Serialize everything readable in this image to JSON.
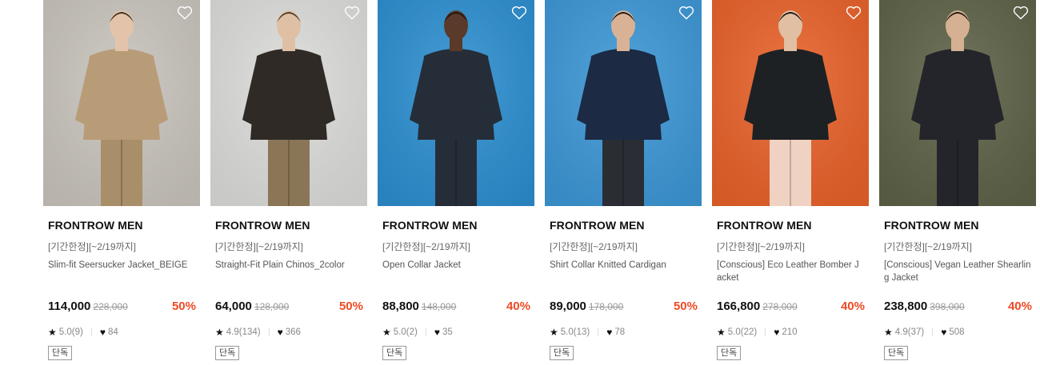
{
  "products": [
    {
      "brand": "FRONTROW MEN",
      "promo": "[기간한정][~2/19까지]",
      "name": "Slim-fit Seersucker Jacket_BEIGE",
      "price": "114,000",
      "original_price": "228,000",
      "discount": "50%",
      "rating": "5.0(9)",
      "likes": "84",
      "badge": "단독",
      "photo_colors": {
        "bg": "#c9c4bd",
        "garment": "#b89c78",
        "pants": "#a98e6a",
        "skin": "#e3c4aa",
        "hair": "#3a2a20"
      }
    },
    {
      "brand": "FRONTROW MEN",
      "promo": "[기간한정][~2/19까지]",
      "name": "Straight-Fit Plain Chinos_2color",
      "price": "64,000",
      "original_price": "128,000",
      "discount": "50%",
      "rating": "4.9(134)",
      "likes": "366",
      "badge": "단독",
      "photo_colors": {
        "bg": "#dcdcda",
        "garment": "#2f2a25",
        "pants": "#8a7657",
        "skin": "#e0c0a4",
        "hair": "#4a3a2a"
      }
    },
    {
      "brand": "FRONTROW MEN",
      "promo": "[기간한정][~2/19까지]",
      "name": "Open Collar Jacket",
      "price": "88,800",
      "original_price": "148,000",
      "discount": "40%",
      "rating": "5.0(2)",
      "likes": "35",
      "badge": "단독",
      "photo_colors": {
        "bg": "#2d8fd0",
        "garment": "#252e38",
        "pants": "#252e38",
        "skin": "#5a3a2a",
        "hair": "#1a1410"
      }
    },
    {
      "brand": "FRONTROW MEN",
      "promo": "[기간한정][~2/19까지]",
      "name": "Shirt Collar Knitted Cardigan",
      "price": "89,000",
      "original_price": "178,000",
      "discount": "50%",
      "rating": "5.0(13)",
      "likes": "78",
      "badge": "단독",
      "photo_colors": {
        "bg": "#3d97d6",
        "garment": "#1c2a44",
        "pants": "#2a2e34",
        "skin": "#d9b296",
        "hair": "#1a1410"
      }
    },
    {
      "brand": "FRONTROW MEN",
      "promo": "[기간한정][~2/19까지]",
      "name": "[Conscious] Eco Leather Bomber Jacket",
      "price": "166,800",
      "original_price": "278,000",
      "discount": "40%",
      "rating": "5.0(22)",
      "likes": "210",
      "badge": "단독",
      "photo_colors": {
        "bg": "#e8622a",
        "garment": "#1d2124",
        "pants": "#f0d2c2",
        "skin": "#e0bfa2",
        "hair": "#1a1410"
      }
    },
    {
      "brand": "FRONTROW MEN",
      "promo": "[기간한정][~2/19까지]",
      "name": "[Conscious] Vegan Leather Shearling Jacket",
      "price": "238,800",
      "original_price": "398,000",
      "discount": "40%",
      "rating": "4.9(37)",
      "likes": "508",
      "badge": "단독",
      "photo_colors": {
        "bg": "#5e6247",
        "garment": "#23252a",
        "pants": "#23252a",
        "skin": "#d6b092",
        "hair": "#1a1410"
      }
    }
  ],
  "icons": {
    "wishlist": "heart-outline-icon",
    "rating": "star-icon",
    "likes": "heart-icon"
  },
  "colors": {
    "discount": "#f04a24",
    "text": "#111111",
    "muted": "#888888"
  }
}
